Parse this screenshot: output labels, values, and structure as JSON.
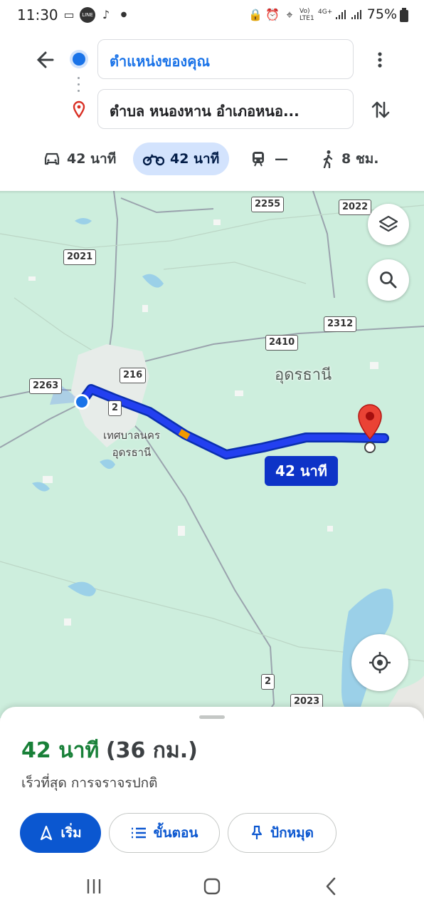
{
  "status_bar": {
    "time": "11:30",
    "battery": "75%",
    "network": "4G+",
    "volte": "Vo) LTE1"
  },
  "header": {
    "origin": "ตำแหน่งของคุณ",
    "destination": "ตำบล หนองหาน อำเภอหนอ..."
  },
  "modes": [
    {
      "name": "car",
      "label": "42 นาที",
      "selected": false
    },
    {
      "name": "motorcycle",
      "label": "42 นาที",
      "selected": true
    },
    {
      "name": "transit",
      "label": "—",
      "selected": false
    },
    {
      "name": "walk",
      "label": "8 ชม.",
      "selected": false
    }
  ],
  "map": {
    "route_label": "42 นาที",
    "city_label_1": "เทศบาลนคร",
    "city_label_2": "อุดรธานี",
    "province_label": "อุดรธานี",
    "road_signs": [
      "2255",
      "2022",
      "2021",
      "2312",
      "2410",
      "216",
      "2263",
      "2",
      "2",
      "2023"
    ]
  },
  "sheet": {
    "eta_time": "42 นาที",
    "eta_distance": "(36 กม.)",
    "subtitle": "เร็วที่สุด การจราจรปกติ",
    "start_label": "เริ่ม",
    "steps_label": "ขั้นตอน",
    "pin_label": "ปักหมุด"
  },
  "colors": {
    "accent": "#0b57d0",
    "route": "#1c3fe0",
    "eta_green": "#188038",
    "map_bg": "#cdeedd"
  }
}
